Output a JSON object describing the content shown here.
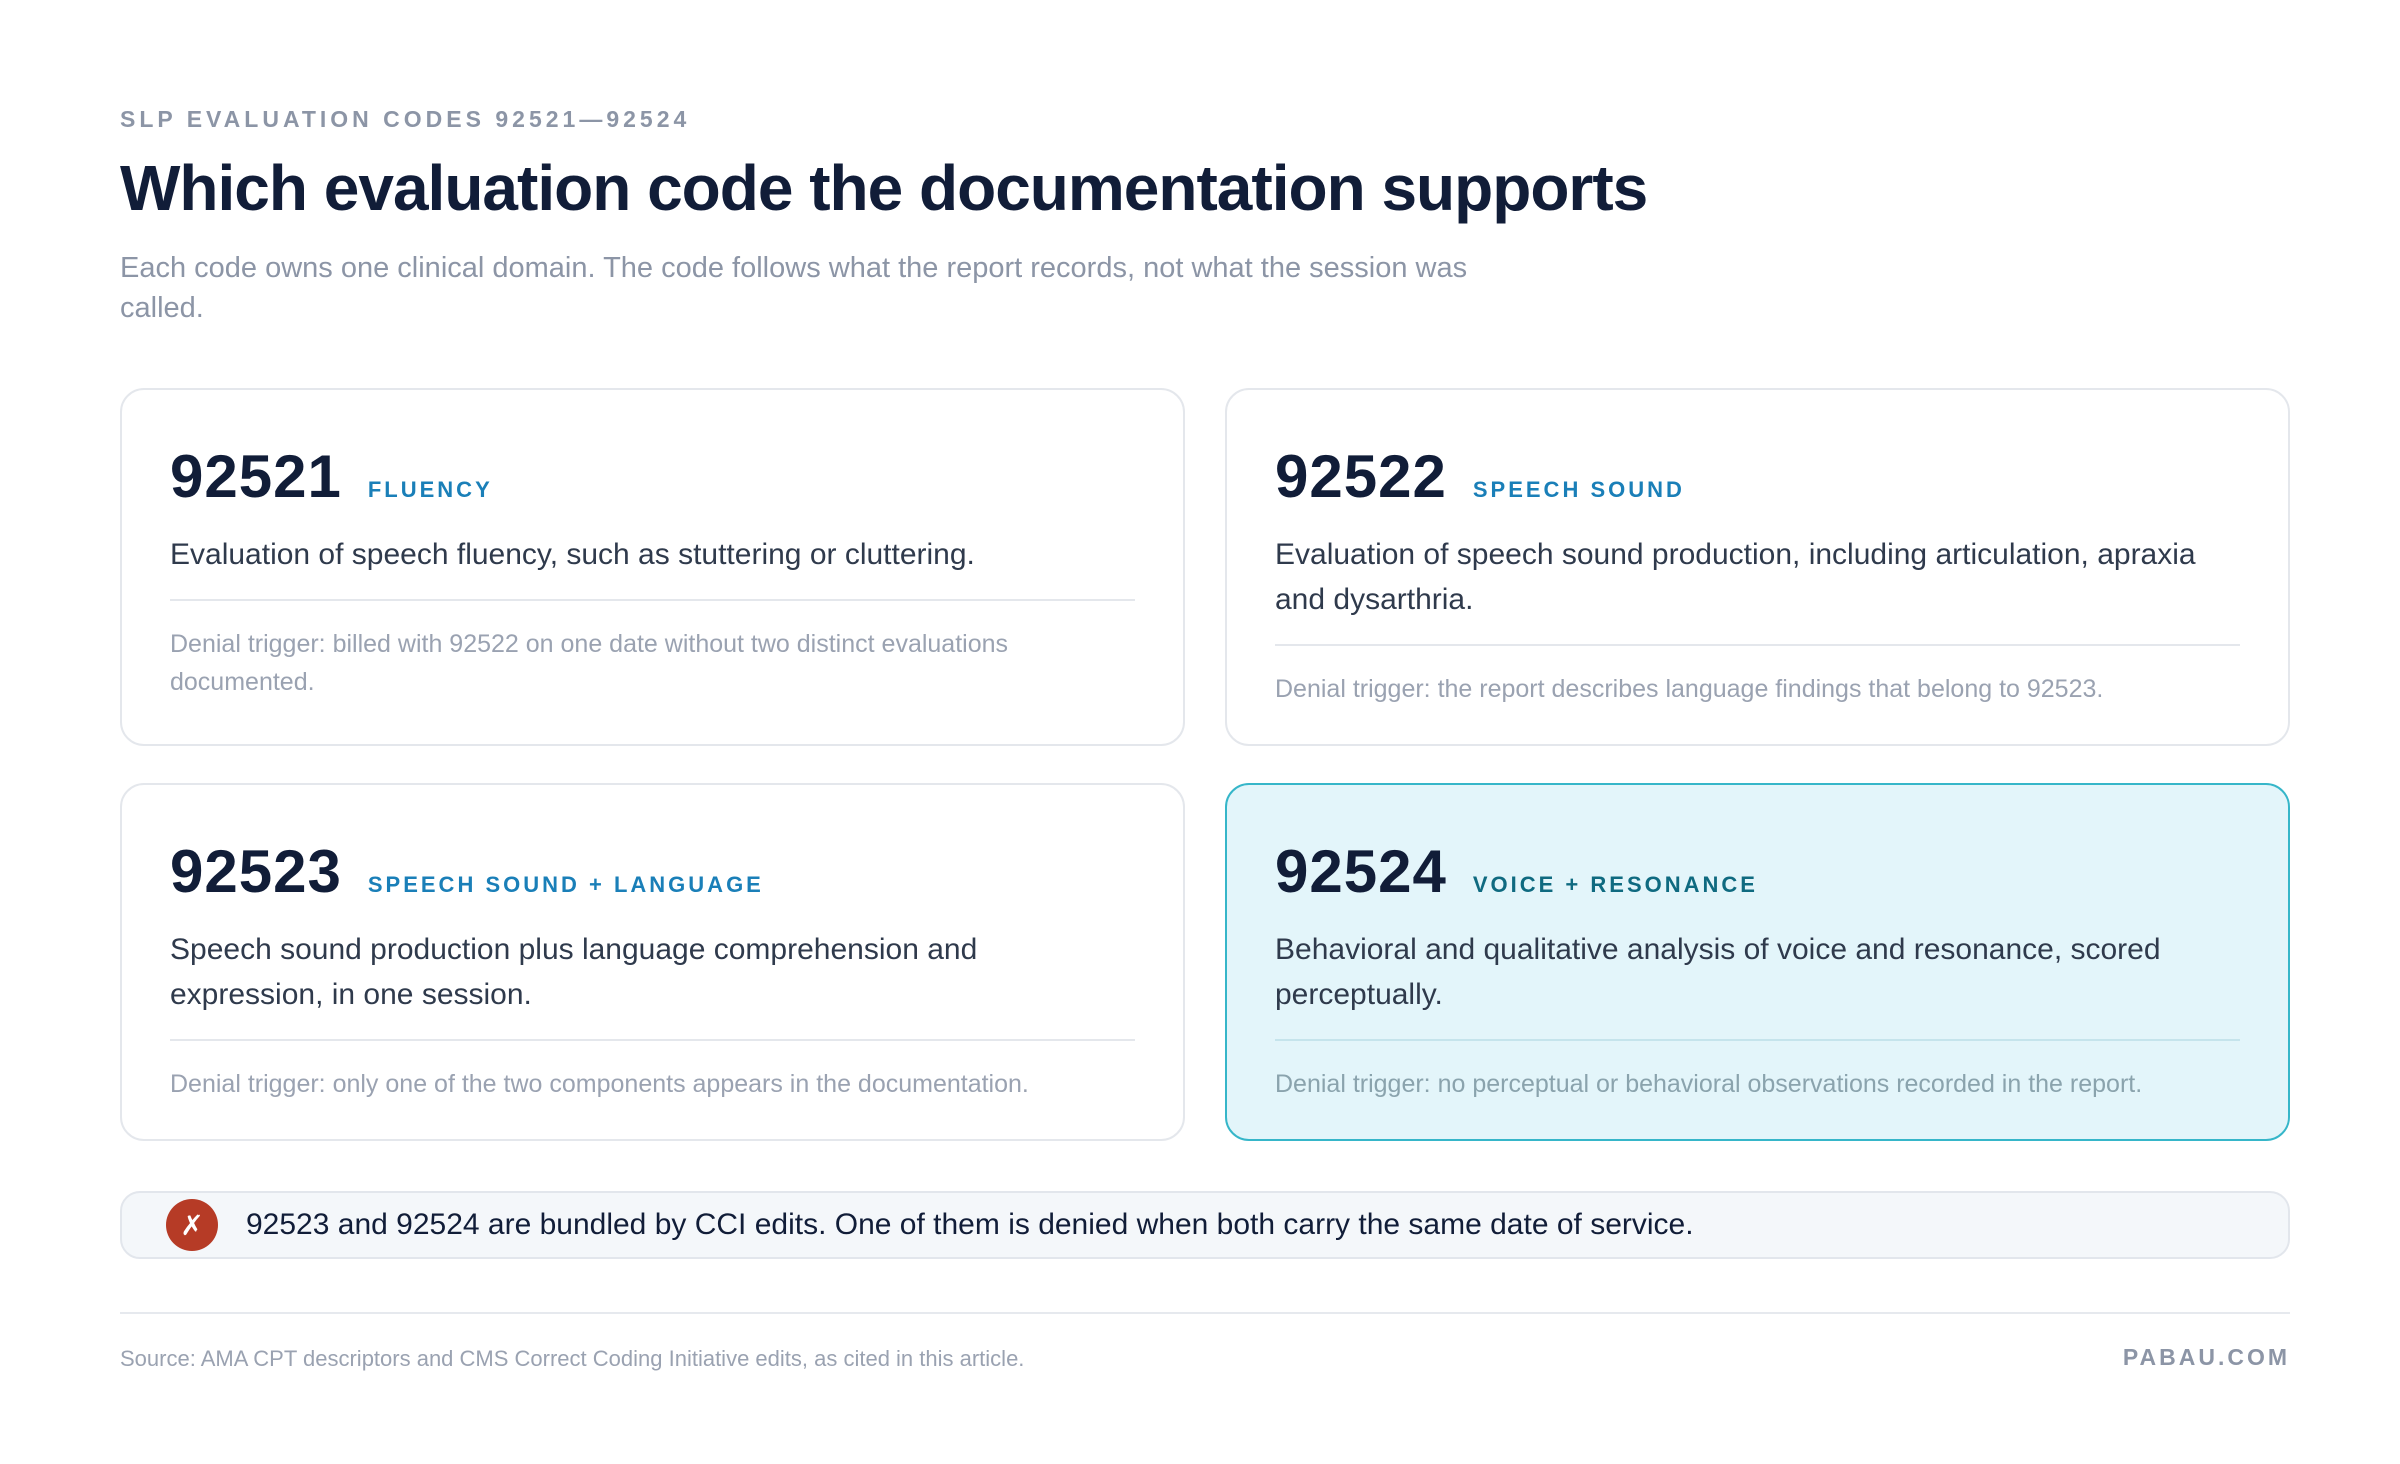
{
  "header": {
    "eyebrow": "SLP EVALUATION CODES 92521—92524",
    "title": "Which evaluation code the documentation supports",
    "subtitle": "Each code owns one clinical domain. The code follows what the report records, not what the session was called."
  },
  "cards": [
    {
      "code": "92521",
      "domain": "FLUENCY",
      "description": "Evaluation of speech fluency, such as stuttering or cluttering.",
      "denial_trigger": "Denial trigger: billed with 92522 on one date without two distinct evaluations documented."
    },
    {
      "code": "92522",
      "domain": "SPEECH SOUND",
      "description": "Evaluation of speech sound production, including articulation, apraxia and dysarthria.",
      "denial_trigger": "Denial trigger: the report describes language findings that belong to 92523."
    },
    {
      "code": "92523",
      "domain": "SPEECH SOUND + LANGUAGE",
      "description": "Speech sound production plus language comprehension and expression, in one session.",
      "denial_trigger": "Denial trigger: only one of the two components appears in the documentation."
    },
    {
      "code": "92524",
      "domain": "VOICE + RESONANCE",
      "description": "Behavioral and qualitative analysis of voice and resonance, scored perceptually.",
      "denial_trigger": "Denial trigger: no perceptual or behavioral observations recorded in the report.",
      "highlighted": true
    }
  ],
  "note": {
    "icon": "cross-icon",
    "icon_glyph": "✗",
    "text": "92523 and 92524 are bundled by CCI edits. One of them is denied when both carry the same date of service."
  },
  "footer": {
    "source": "Source: AMA CPT descriptors and CMS Correct Coding Initiative edits, as cited in this article.",
    "brand": "PABAU.COM"
  },
  "colors": {
    "title": "#111d38",
    "accent_blue": "#1a7fb8",
    "highlight_bg": "#e3f5fa",
    "highlight_border": "#36b6c9",
    "warning_red": "#b63b26",
    "muted_gray": "#8c95a6"
  }
}
